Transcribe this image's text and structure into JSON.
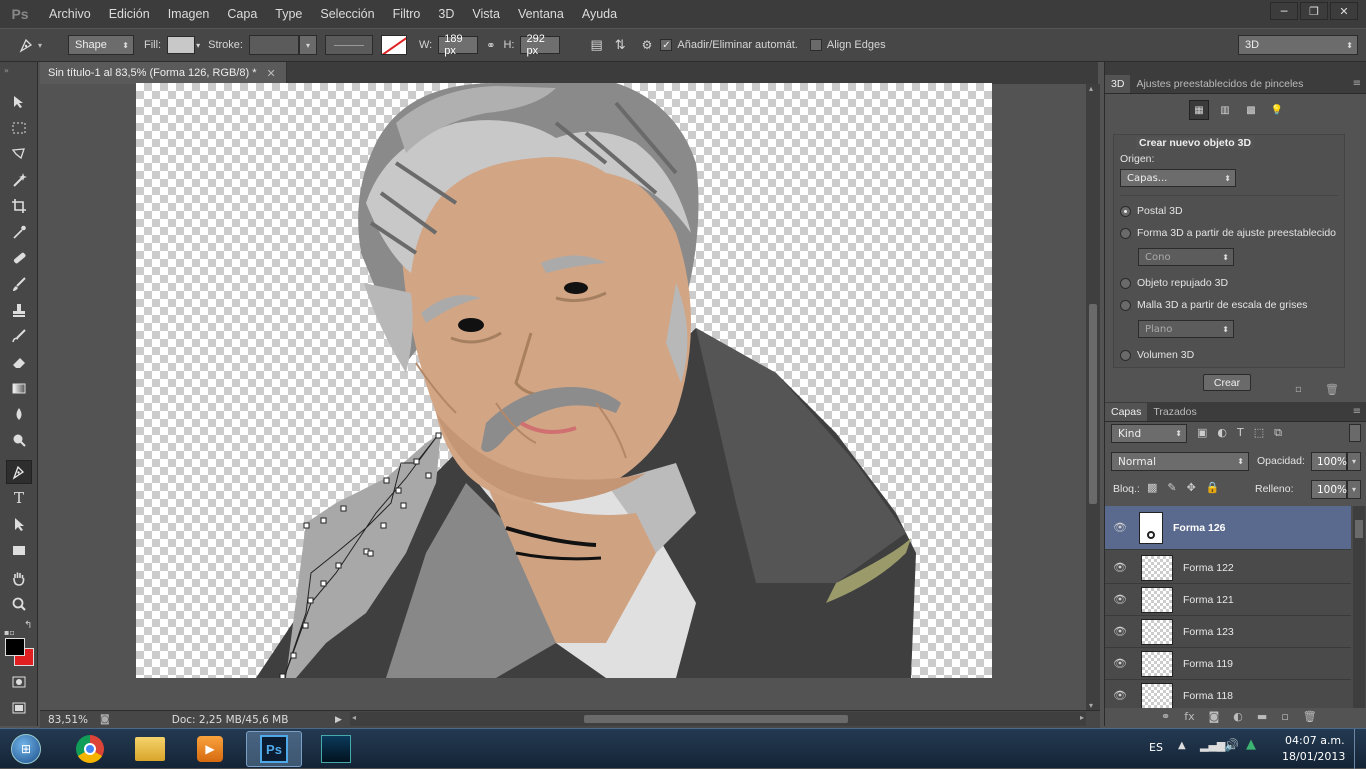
{
  "app": {
    "logo": "Ps"
  },
  "menu": [
    "Archivo",
    "Edición",
    "Imagen",
    "Capa",
    "Type",
    "Selección",
    "Filtro",
    "3D",
    "Vista",
    "Ventana",
    "Ayuda"
  ],
  "options": {
    "tool_mode": "Shape",
    "fill_label": "Fill:",
    "stroke_label": "Stroke:",
    "w_label": "W:",
    "w_value": "189 px",
    "h_label": "H:",
    "h_value": "292 px",
    "auto_add_delete": "Añadir/Eliminar automát.",
    "align_edges": "Align Edges",
    "workspace": "3D"
  },
  "document": {
    "tab_title": "Sin título-1 al 83,5% (Forma 126, RGB/8) *",
    "zoom": "83,51%",
    "doc_info": "Doc: 2,25 MB/45,6 MB"
  },
  "panel3d": {
    "tabs": [
      "3D",
      "Ajustes preestablecidos de pinceles"
    ],
    "section_title": "Crear nuevo objeto 3D",
    "source_label": "Origen:",
    "source_value": "Capas...",
    "options": [
      "Postal 3D",
      "Forma 3D a partir de ajuste preestablecido",
      "Objeto repujado 3D",
      "Malla 3D a partir de escala de grises",
      "Volumen 3D"
    ],
    "preset_shape": "Cono",
    "preset_mesh": "Plano",
    "create_button": "Crear"
  },
  "layers_panel": {
    "tabs": [
      "Capas",
      "Trazados"
    ],
    "filter_kind": "Kind",
    "blend_mode": "Normal",
    "opacity_label": "Opacidad:",
    "opacity_value": "100%",
    "lock_label": "Bloq.:",
    "fill_label": "Relleno:",
    "fill_value": "100%",
    "layers": [
      {
        "name": "Forma 126",
        "selected": true
      },
      {
        "name": "Forma 122",
        "selected": false
      },
      {
        "name": "Forma 121",
        "selected": false
      },
      {
        "name": "Forma 123",
        "selected": false
      },
      {
        "name": "Forma 119",
        "selected": false
      },
      {
        "name": "Forma 118",
        "selected": false
      }
    ]
  },
  "taskbar": {
    "language": "ES",
    "time": "04:07 a.m.",
    "date": "18/01/2013",
    "apps": [
      "windows-start",
      "chrome",
      "file-explorer",
      "media-player",
      "photoshop",
      "other-app"
    ]
  },
  "colors": {
    "foreground": "#000000",
    "background": "#e02020",
    "selected_layer": "#5a6a8e"
  }
}
